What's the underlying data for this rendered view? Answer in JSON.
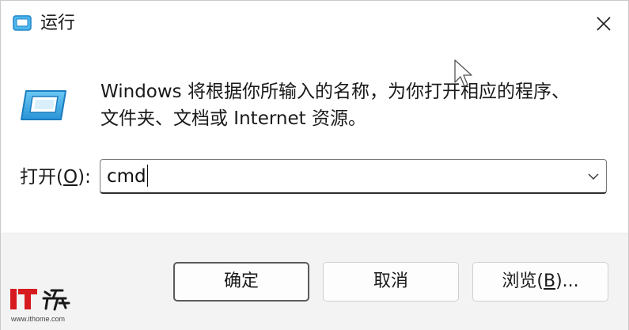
{
  "window": {
    "title": "运行",
    "close_icon": "close-icon"
  },
  "description": {
    "line1": "Windows 将根据你所输入的名称，为你打开相应的程序、",
    "line2": "文件夹、文档或 Internet 资源。"
  },
  "open_field": {
    "label_prefix": "打开(",
    "label_mnemonic": "O",
    "label_suffix": "):",
    "value": "cmd"
  },
  "buttons": {
    "ok": "确定",
    "cancel": "取消",
    "browse_prefix": "浏览(",
    "browse_mnemonic": "B",
    "browse_suffix": ")..."
  },
  "watermark": {
    "url": "www.ithome.com"
  },
  "colors": {
    "footer_bg": "#f3f3f3",
    "icon_blue": "#2f9fe0",
    "watermark_red": "#d71920"
  }
}
